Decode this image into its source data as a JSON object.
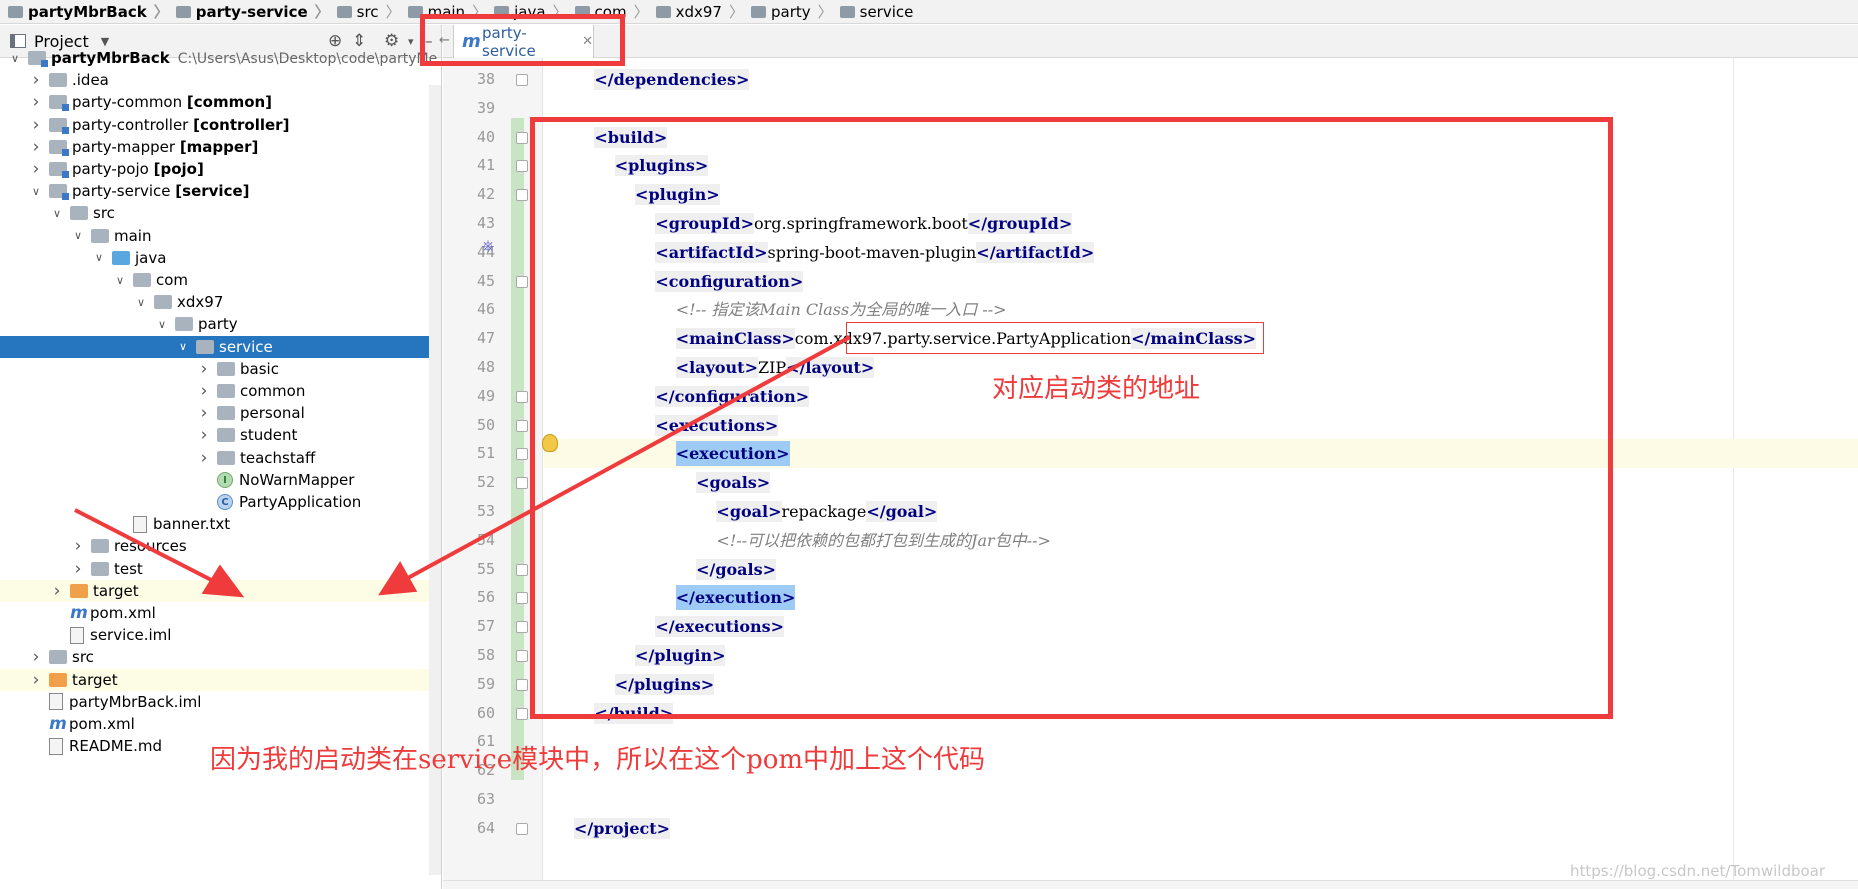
{
  "breadcrumb": [
    {
      "label": "partyMbrBack",
      "bold": true
    },
    {
      "label": "party-service",
      "bold": true
    },
    {
      "label": "src",
      "bold": false
    },
    {
      "label": "main",
      "bold": false
    },
    {
      "label": "java",
      "bold": false
    },
    {
      "label": "com",
      "bold": false
    },
    {
      "label": "xdx97",
      "bold": false
    },
    {
      "label": "party",
      "bold": false
    },
    {
      "label": "service",
      "bold": false
    }
  ],
  "project_panel": {
    "title": "Project",
    "tree": [
      {
        "label": "partyMbrBack",
        "bold_part": "",
        "path": "C:\\Users\\Asus\\Desktop\\code\\partyMe",
        "indent": 0,
        "arrow": "down",
        "icon": "mod",
        "bold": true
      },
      {
        "label": ".idea",
        "bold_part": "",
        "indent": 1,
        "arrow": "right",
        "icon": "grey"
      },
      {
        "label": "party-common ",
        "bold_part": "[common]",
        "indent": 1,
        "arrow": "right",
        "icon": "mod"
      },
      {
        "label": "party-controller ",
        "bold_part": "[controller]",
        "indent": 1,
        "arrow": "right",
        "icon": "mod"
      },
      {
        "label": "party-mapper ",
        "bold_part": "[mapper]",
        "indent": 1,
        "arrow": "right",
        "icon": "mod"
      },
      {
        "label": "party-pojo ",
        "bold_part": "[pojo]",
        "indent": 1,
        "arrow": "right",
        "icon": "mod"
      },
      {
        "label": "party-service ",
        "bold_part": "[service]",
        "indent": 1,
        "arrow": "down",
        "icon": "mod"
      },
      {
        "label": "src",
        "bold_part": "",
        "indent": 2,
        "arrow": "down",
        "icon": "grey"
      },
      {
        "label": "main",
        "bold_part": "",
        "indent": 3,
        "arrow": "down",
        "icon": "grey"
      },
      {
        "label": "java",
        "bold_part": "",
        "indent": 4,
        "arrow": "down",
        "icon": "blue"
      },
      {
        "label": "com",
        "bold_part": "",
        "indent": 5,
        "arrow": "down",
        "icon": "grey"
      },
      {
        "label": "xdx97",
        "bold_part": "",
        "indent": 6,
        "arrow": "down",
        "icon": "grey"
      },
      {
        "label": "party",
        "bold_part": "",
        "indent": 7,
        "arrow": "down",
        "icon": "grey"
      },
      {
        "label": "service",
        "bold_part": "",
        "indent": 8,
        "arrow": "down",
        "icon": "grey",
        "selected": true
      },
      {
        "label": "basic",
        "bold_part": "",
        "indent": 9,
        "arrow": "right",
        "icon": "grey"
      },
      {
        "label": "common",
        "bold_part": "",
        "indent": 9,
        "arrow": "right",
        "icon": "grey"
      },
      {
        "label": "personal",
        "bold_part": "",
        "indent": 9,
        "arrow": "right",
        "icon": "grey"
      },
      {
        "label": "student",
        "bold_part": "",
        "indent": 9,
        "arrow": "right",
        "icon": "grey"
      },
      {
        "label": "teachstaff",
        "bold_part": "",
        "indent": 9,
        "arrow": "right",
        "icon": "grey"
      },
      {
        "label": "NoWarnMapper",
        "bold_part": "",
        "indent": 9,
        "arrow": "none",
        "icon": "interface"
      },
      {
        "label": "PartyApplication",
        "bold_part": "",
        "indent": 9,
        "arrow": "none",
        "icon": "class"
      },
      {
        "label": "banner.txt",
        "bold_part": "",
        "indent": 5,
        "arrow": "none",
        "icon": "file"
      },
      {
        "label": "resources",
        "bold_part": "",
        "indent": 3,
        "arrow": "right",
        "icon": "grey"
      },
      {
        "label": "test",
        "bold_part": "",
        "indent": 3,
        "arrow": "right",
        "icon": "grey"
      },
      {
        "label": "target",
        "bold_part": "",
        "indent": 2,
        "arrow": "right",
        "icon": "orange",
        "highlight": true
      },
      {
        "label": "pom.xml",
        "bold_part": "",
        "indent": 2,
        "arrow": "none",
        "icon": "maven"
      },
      {
        "label": "service.iml",
        "bold_part": "",
        "indent": 2,
        "arrow": "none",
        "icon": "file"
      },
      {
        "label": "src",
        "bold_part": "",
        "indent": 1,
        "arrow": "right",
        "icon": "grey"
      },
      {
        "label": "target",
        "bold_part": "",
        "indent": 1,
        "arrow": "right",
        "icon": "orange",
        "highlight": true
      },
      {
        "label": "partyMbrBack.iml",
        "bold_part": "",
        "indent": 1,
        "arrow": "none",
        "icon": "file"
      },
      {
        "label": "pom.xml",
        "bold_part": "",
        "indent": 1,
        "arrow": "none",
        "icon": "maven"
      },
      {
        "label": "README.md",
        "bold_part": "",
        "indent": 1,
        "arrow": "none",
        "icon": "file"
      }
    ]
  },
  "editor": {
    "tab_label": "party-service",
    "lines": [
      {
        "num": "38",
        "parts": [
          [
            "s",
            "    "
          ],
          [
            "t",
            "</dependencies>"
          ]
        ]
      },
      {
        "num": "39",
        "parts": []
      },
      {
        "num": "40",
        "parts": [
          [
            "s",
            "    "
          ],
          [
            "t",
            "<build>"
          ]
        ]
      },
      {
        "num": "41",
        "parts": [
          [
            "s",
            "        "
          ],
          [
            "t",
            "<plugins>"
          ]
        ]
      },
      {
        "num": "42",
        "parts": [
          [
            "s",
            "            "
          ],
          [
            "t",
            "<plugin>"
          ]
        ]
      },
      {
        "num": "43",
        "parts": [
          [
            "s",
            "                "
          ],
          [
            "t",
            "<groupId>"
          ],
          [
            "x",
            "org.springframework.boot"
          ],
          [
            "t",
            "</groupId>"
          ]
        ]
      },
      {
        "num": "44",
        "parts": [
          [
            "s",
            "                "
          ],
          [
            "t",
            "<artifactId>"
          ],
          [
            "x",
            "spring-boot-maven-plugin"
          ],
          [
            "t",
            "</artifactId>"
          ]
        ]
      },
      {
        "num": "45",
        "parts": [
          [
            "s",
            "                "
          ],
          [
            "t",
            "<configuration>"
          ]
        ]
      },
      {
        "num": "46",
        "parts": [
          [
            "s",
            "                    "
          ],
          [
            "c",
            "<!-- 指定该Main Class为全局的唯一入口 -->"
          ]
        ]
      },
      {
        "num": "47",
        "parts": [
          [
            "s",
            "                    "
          ],
          [
            "t",
            "<mainClass>"
          ],
          [
            "x",
            "com.xdx97.party.service.PartyApplication"
          ],
          [
            "t",
            "</mainClass>"
          ]
        ]
      },
      {
        "num": "48",
        "parts": [
          [
            "s",
            "                    "
          ],
          [
            "t",
            "<layout>"
          ],
          [
            "x",
            "ZIP"
          ],
          [
            "t",
            "</layout>"
          ]
        ]
      },
      {
        "num": "49",
        "parts": [
          [
            "s",
            "                "
          ],
          [
            "t",
            "</configuration>"
          ]
        ]
      },
      {
        "num": "50",
        "parts": [
          [
            "s",
            "                "
          ],
          [
            "t",
            "<executions>"
          ]
        ]
      },
      {
        "num": "51",
        "parts": [
          [
            "s",
            "                    "
          ],
          [
            "h",
            "<execution>"
          ]
        ],
        "current": true
      },
      {
        "num": "52",
        "parts": [
          [
            "s",
            "                        "
          ],
          [
            "t",
            "<goals>"
          ]
        ]
      },
      {
        "num": "53",
        "parts": [
          [
            "s",
            "                            "
          ],
          [
            "t",
            "<goal>"
          ],
          [
            "x",
            "repackage"
          ],
          [
            "t",
            "</goal>"
          ]
        ]
      },
      {
        "num": "54",
        "parts": [
          [
            "s",
            "                            "
          ],
          [
            "c",
            "<!--可以把依赖的包都打包到生成的Jar包中-->"
          ]
        ]
      },
      {
        "num": "55",
        "parts": [
          [
            "s",
            "                        "
          ],
          [
            "t",
            "</goals>"
          ]
        ]
      },
      {
        "num": "56",
        "parts": [
          [
            "s",
            "                    "
          ],
          [
            "h",
            "</execution>"
          ]
        ]
      },
      {
        "num": "57",
        "parts": [
          [
            "s",
            "                "
          ],
          [
            "t",
            "</executions>"
          ]
        ]
      },
      {
        "num": "58",
        "parts": [
          [
            "s",
            "            "
          ],
          [
            "t",
            "</plugin>"
          ]
        ]
      },
      {
        "num": "59",
        "parts": [
          [
            "s",
            "        "
          ],
          [
            "t",
            "</plugins>"
          ]
        ]
      },
      {
        "num": "60",
        "parts": [
          [
            "s",
            "    "
          ],
          [
            "t",
            "</build>"
          ]
        ]
      },
      {
        "num": "61",
        "parts": []
      },
      {
        "num": "62",
        "parts": []
      },
      {
        "num": "63",
        "parts": []
      },
      {
        "num": "64",
        "parts": [
          [
            "t",
            "</project>"
          ]
        ]
      }
    ]
  },
  "annotations": {
    "mainclass_note": "对应启动类的地址",
    "bottom_note": "因为我的启动类在service模块中，所以在这个pom中加上这个代码"
  },
  "watermark": "https://blog.csdn.net/Tomwildboar",
  "colors": {
    "annotation_red": "#ef3b3b",
    "selection_blue": "#2675bf",
    "tag_blue": "#000080",
    "comment_grey": "#808080"
  }
}
